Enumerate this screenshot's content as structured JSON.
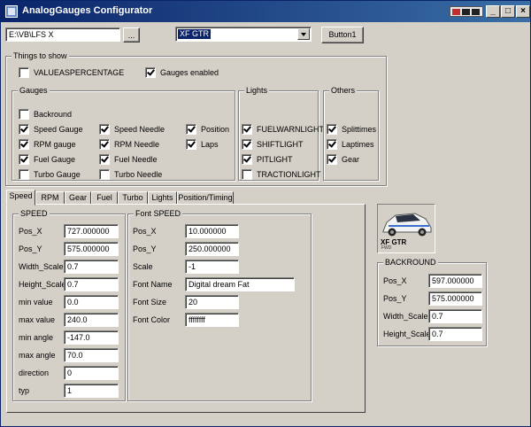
{
  "window": {
    "title": "AnalogGauges Configurator",
    "accent": "#0a246a"
  },
  "toolbar": {
    "path_value": "E:\\VB\\LFS X",
    "browse_label": "...",
    "car_selected": "XF GTR",
    "button1_label": "Button1"
  },
  "things_to_show": {
    "legend": "Things to show",
    "valueaspercentage": {
      "label": "VALUEASPERCENTAGE",
      "checked": false
    },
    "gauges_enabled": {
      "label": "Gauges enabled",
      "checked": true
    }
  },
  "gauges": {
    "legend": "Gauges",
    "items": [
      {
        "label": "Backround",
        "checked": false
      },
      {
        "label": "Speed Gauge",
        "checked": true
      },
      {
        "label": "Speed Needle",
        "checked": true
      },
      {
        "label": "Position",
        "checked": true
      },
      {
        "label": "RPM gauge",
        "checked": true
      },
      {
        "label": "RPM Needle",
        "checked": true
      },
      {
        "label": "Laps",
        "checked": true
      },
      {
        "label": "Fuel Gauge",
        "checked": true
      },
      {
        "label": "Fuel Needle",
        "checked": true
      },
      {
        "label": "Turbo Gauge",
        "checked": false
      },
      {
        "label": "Turbo Needle",
        "checked": false
      }
    ]
  },
  "lights": {
    "legend": "Lights",
    "items": [
      {
        "label": "FUELWARNLIGHT",
        "checked": true
      },
      {
        "label": "SHIFTLIGHT",
        "checked": true
      },
      {
        "label": "PITLIGHT",
        "checked": true
      },
      {
        "label": "TRACTIONLIGHT",
        "checked": false
      }
    ]
  },
  "others": {
    "legend": "Others",
    "items": [
      {
        "label": "Splittimes",
        "checked": true
      },
      {
        "label": "Laptimes",
        "checked": true
      },
      {
        "label": "Gear",
        "checked": true
      }
    ]
  },
  "tabs": [
    "Speed",
    "RPM",
    "Gear",
    "Fuel",
    "Turbo",
    "Lights",
    "Position/Timing"
  ],
  "speed": {
    "legend": "SPEED",
    "fields": [
      {
        "label": "Pos_X",
        "value": "727.000000"
      },
      {
        "label": "Pos_Y",
        "value": "575.000000"
      },
      {
        "label": "Width_Scale",
        "value": "0.7"
      },
      {
        "label": "Height_Scale",
        "value": "0.7"
      },
      {
        "label": "min value",
        "value": "0.0"
      },
      {
        "label": "max value",
        "value": "240.0"
      },
      {
        "label": "min angle",
        "value": "-147.0"
      },
      {
        "label": "max angle",
        "value": "70.0"
      },
      {
        "label": "direction",
        "value": "0"
      },
      {
        "label": "typ",
        "value": "1"
      }
    ]
  },
  "font_speed": {
    "legend": "Font SPEED",
    "fields": [
      {
        "label": "Pos_X",
        "value": "10.000000"
      },
      {
        "label": "Pos_Y",
        "value": "250.000000"
      },
      {
        "label": "Scale",
        "value": "-1"
      },
      {
        "label": "Font Name",
        "value": "Digital dream Fat"
      },
      {
        "label": "Font Size",
        "value": "20"
      },
      {
        "label": "Font Color",
        "value": "ffffffff"
      }
    ]
  },
  "car_preview": {
    "name": "XF GTR",
    "sub": "FWD"
  },
  "backround": {
    "legend": "BACKROUND",
    "fields": [
      {
        "label": "Pos_X",
        "value": "597.000000"
      },
      {
        "label": "Pos_Y",
        "value": "575.000000"
      },
      {
        "label": "Width_Scale",
        "value": "0.7"
      },
      {
        "label": "Height_Scale",
        "value": "0.7"
      }
    ]
  }
}
